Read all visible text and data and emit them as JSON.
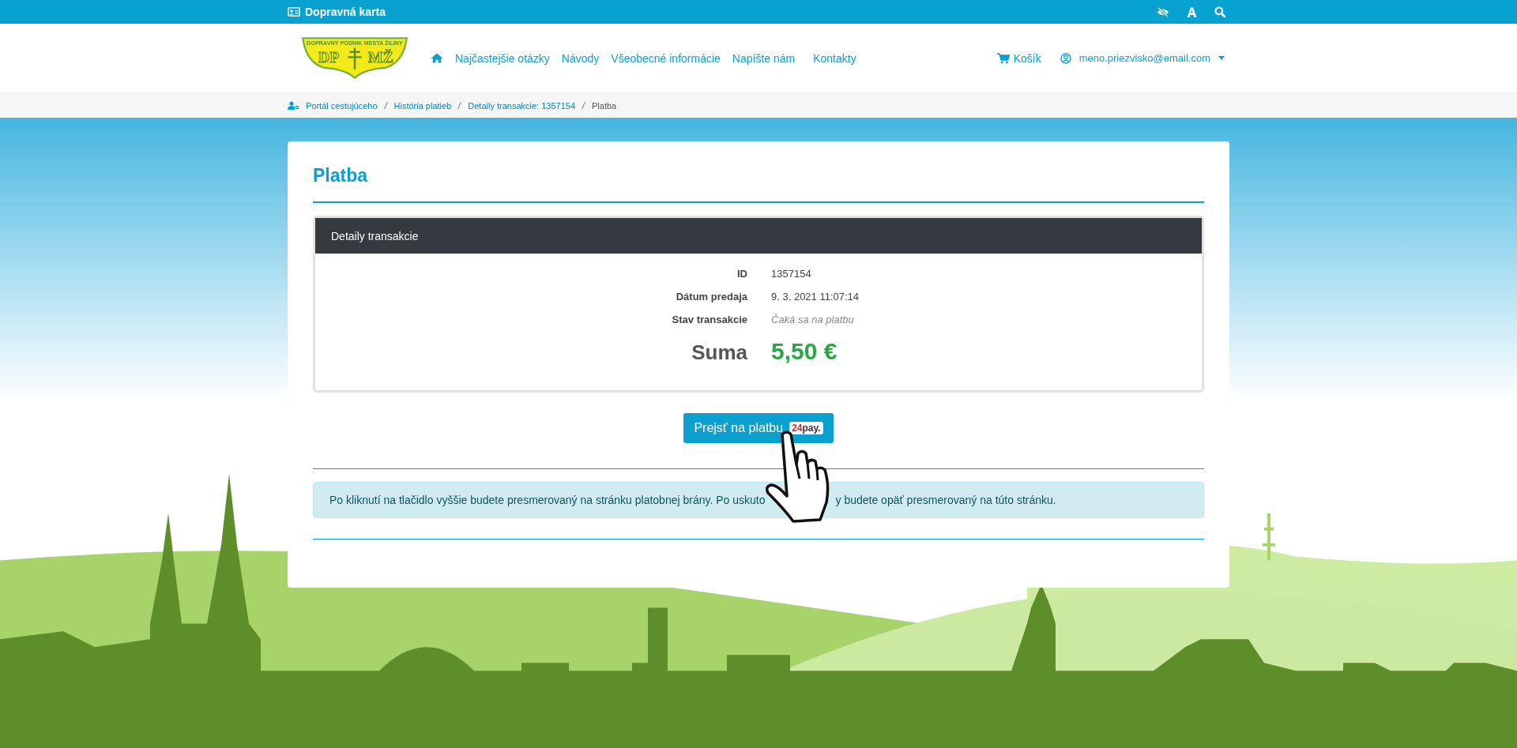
{
  "topbar": {
    "title": "Dopravná karta"
  },
  "logo": {
    "top_text": "DOPRAVNÝ PODNIK MESTA ŽILINY",
    "left": "DP",
    "right": "MŽ"
  },
  "nav": [
    "Najčastejšie otázky",
    "Návody",
    "Všeobecné informácie",
    "Napíšte nám",
    "Kontakty"
  ],
  "cart": "Košík",
  "user": "meno.priezvisko@email.com",
  "breadcrumb": [
    {
      "label": "Portál cestujúceho",
      "current": false
    },
    {
      "label": "História platieb",
      "current": false
    },
    {
      "label": "Detaily transakcie: 1357154",
      "current": false
    },
    {
      "label": "Platba",
      "current": true
    }
  ],
  "page_title": "Platba",
  "panel": {
    "title": "Detaily transakcie",
    "rows": [
      {
        "label": "ID",
        "value": "1357154",
        "kind": "plain"
      },
      {
        "label": "Dátum predaja",
        "value": "9. 3. 2021 11:07:14",
        "kind": "plain"
      },
      {
        "label": "Stav transakcie",
        "value": "Čaká sa na platbu",
        "kind": "status"
      },
      {
        "label": "Suma",
        "value": "5,50 €",
        "kind": "total"
      }
    ]
  },
  "pay_button": {
    "label": "Prejsť na platbu",
    "badge_number": "24",
    "badge_suffix": "pay."
  },
  "notice": [
    "Po kliknutí na tlačidlo vyššie budete presmerovaný na stránku platobnej brány. Po uskuto",
    "y budete opäť presmerovaný na túto stránku."
  ]
}
